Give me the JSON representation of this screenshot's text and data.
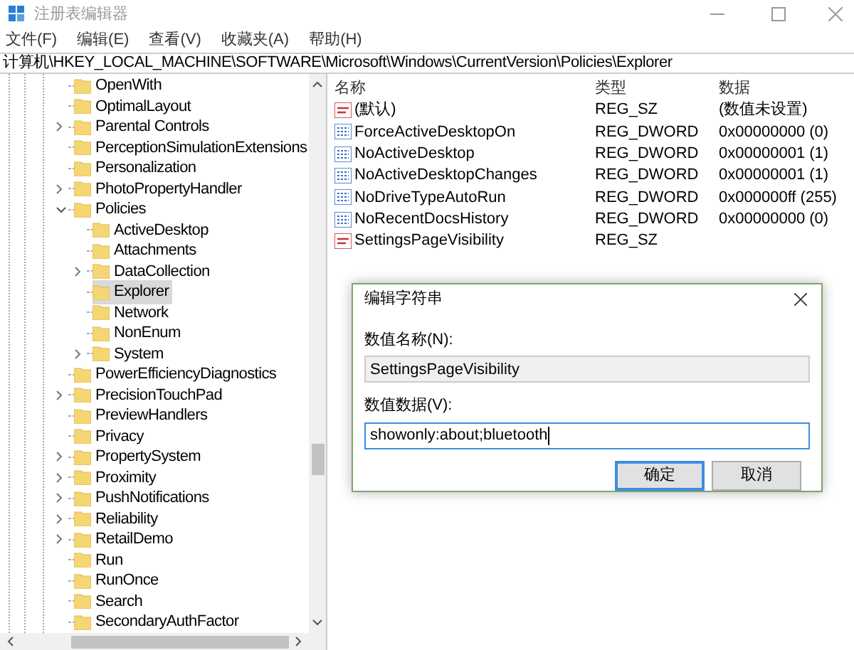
{
  "window": {
    "title": "注册表编辑器"
  },
  "menu": [
    "文件(F)",
    "编辑(E)",
    "查看(V)",
    "收藏夹(A)",
    "帮助(H)"
  ],
  "address": "计算机\\HKEY_LOCAL_MACHINE\\SOFTWARE\\Microsoft\\Windows\\CurrentVersion\\Policies\\Explorer",
  "tree": [
    {
      "label": "OpenWith",
      "selected": false
    },
    {
      "label": "OptimalLayout",
      "selected": false
    },
    {
      "label": "Parental Controls",
      "expanded": false,
      "selected": false
    },
    {
      "label": "PerceptionSimulationExtensions",
      "selected": false
    },
    {
      "label": "Personalization",
      "selected": false
    },
    {
      "label": "PhotoPropertyHandler",
      "expanded": false,
      "selected": false
    },
    {
      "label": "Policies",
      "expanded": true,
      "selected": false,
      "children": [
        {
          "label": "ActiveDesktop",
          "selected": false
        },
        {
          "label": "Attachments",
          "selected": false
        },
        {
          "label": "DataCollection",
          "expanded": false,
          "selected": false
        },
        {
          "label": "Explorer",
          "selected": true
        },
        {
          "label": "Network",
          "selected": false
        },
        {
          "label": "NonEnum",
          "selected": false
        },
        {
          "label": "System",
          "expanded": false,
          "selected": false
        }
      ]
    },
    {
      "label": "PowerEfficiencyDiagnostics",
      "selected": false
    },
    {
      "label": "PrecisionTouchPad",
      "expanded": false,
      "selected": false
    },
    {
      "label": "PreviewHandlers",
      "selected": false
    },
    {
      "label": "Privacy",
      "selected": false
    },
    {
      "label": "PropertySystem",
      "expanded": false,
      "selected": false
    },
    {
      "label": "Proximity",
      "expanded": false,
      "selected": false
    },
    {
      "label": "PushNotifications",
      "expanded": false,
      "selected": false
    },
    {
      "label": "Reliability",
      "expanded": false,
      "selected": false
    },
    {
      "label": "RetailDemo",
      "expanded": false,
      "selected": false
    },
    {
      "label": "Run",
      "selected": false
    },
    {
      "label": "RunOnce",
      "selected": false
    },
    {
      "label": "Search",
      "selected": false
    },
    {
      "label": "SecondaryAuthFactor",
      "selected": false
    }
  ],
  "values": {
    "columns": [
      "名称",
      "类型",
      "数据"
    ],
    "rows": [
      {
        "kind": "string",
        "name": "(默认)",
        "type": "REG_SZ",
        "data": "(数值未设置)"
      },
      {
        "kind": "dword",
        "name": "ForceActiveDesktopOn",
        "type": "REG_DWORD",
        "data": "0x00000000 (0)"
      },
      {
        "kind": "dword",
        "name": "NoActiveDesktop",
        "type": "REG_DWORD",
        "data": "0x00000001 (1)"
      },
      {
        "kind": "dword",
        "name": "NoActiveDesktopChanges",
        "type": "REG_DWORD",
        "data": "0x00000001 (1)"
      },
      {
        "kind": "dword",
        "name": "NoDriveTypeAutoRun",
        "type": "REG_DWORD",
        "data": "0x000000ff (255)"
      },
      {
        "kind": "dword",
        "name": "NoRecentDocsHistory",
        "type": "REG_DWORD",
        "data": "0x00000000 (0)"
      },
      {
        "kind": "string",
        "name": "SettingsPageVisibility",
        "type": "REG_SZ"
      }
    ]
  },
  "dialog": {
    "title": "编辑字符串",
    "name_label": "数值名称(N):",
    "name_value": "SettingsPageVisibility",
    "data_label": "数值数据(V):",
    "data_value": "showonly:about;bluetooth",
    "buttons": [
      {
        "label": "确定",
        "default": true
      },
      {
        "label": "取消",
        "default": false
      }
    ]
  }
}
